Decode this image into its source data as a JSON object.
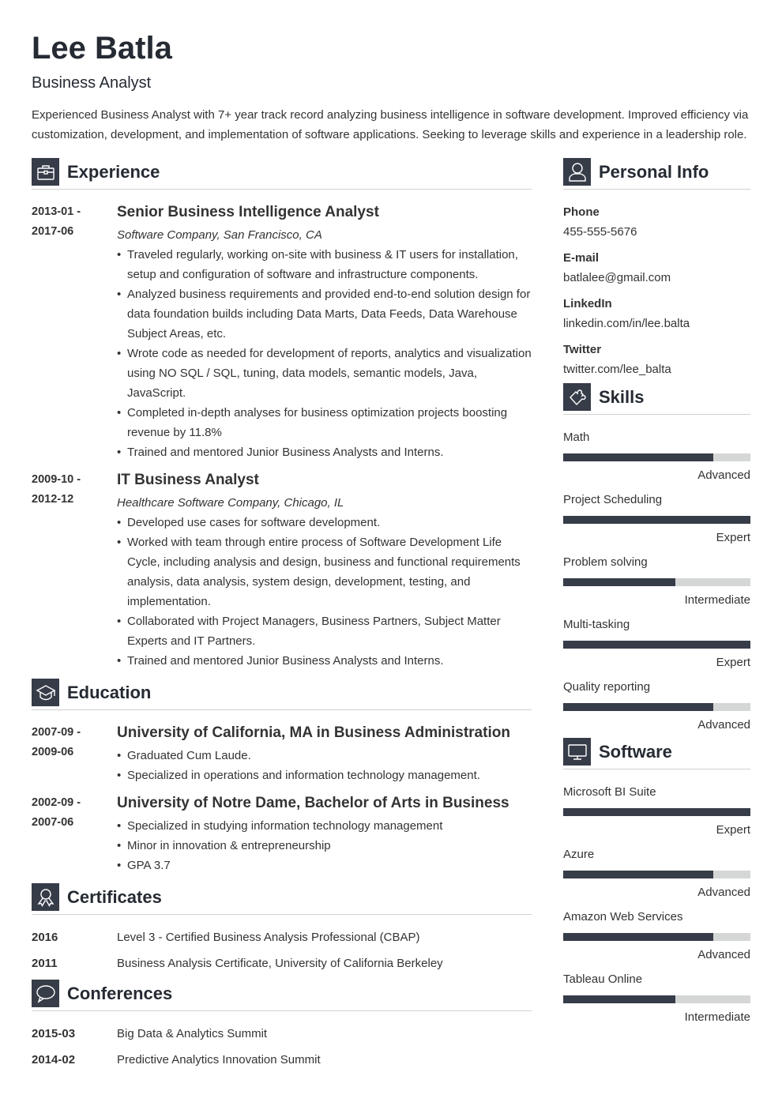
{
  "header": {
    "name": "Lee Batla",
    "title": "Business Analyst",
    "summary": "Experienced Business Analyst with 7+ year track record analyzing business intelligence in software development. Improved efficiency via customization, development, and implementation of software applications. Seeking to leverage skills and experience in a leadership role."
  },
  "experience": {
    "heading": "Experience",
    "icon": "briefcase-icon",
    "items": [
      {
        "date_start": "2013-01 -",
        "date_end": "2017-06",
        "title": "Senior Business Intelligence Analyst",
        "company": " Software Company, San Francisco, CA",
        "bullets": [
          "Traveled regularly, working on-site with business & IT users for installation, setup and configuration of software and infrastructure components.",
          "Analyzed business requirements and provided end-to-end solution design for data foundation builds including Data Marts, Data Feeds, Data Warehouse Subject Areas, etc.",
          "Wrote code as needed for development of reports, analytics and visualization using NO SQL / SQL, tuning, data models, semantic models, Java, JavaScript.",
          "Completed in-depth analyses for business optimization projects boosting revenue by 11.8%",
          "Trained and mentored Junior Business Analysts and Interns."
        ]
      },
      {
        "date_start": "2009-10 -",
        "date_end": "2012-12",
        "title": "IT Business Analyst",
        "company": "Healthcare Software Company, Chicago, IL",
        "bullets": [
          "Developed use cases for software development.",
          "Worked with team through entire process of Software Development Life Cycle, including analysis and design, business and functional requirements analysis, data analysis, system design, development, testing, and implementation.",
          "Collaborated with Project Managers, Business Partners, Subject Matter Experts and IT Partners.",
          "Trained and mentored Junior Business Analysts and Interns."
        ]
      }
    ]
  },
  "education": {
    "heading": "Education",
    "icon": "graduation-cap-icon",
    "items": [
      {
        "date_start": "2007-09 -",
        "date_end": "2009-06",
        "title": "University of California, MA in Business Administration",
        "bullets": [
          "Graduated Cum Laude.",
          "Specialized in operations and information technology management."
        ]
      },
      {
        "date_start": "2002-09 -",
        "date_end": "2007-06",
        "title": "University of Notre Dame, Bachelor of Arts in Business",
        "bullets": [
          "Specialized in studying information technology management",
          "Minor in innovation & entrepreneurship",
          "GPA 3.7"
        ]
      }
    ]
  },
  "certificates": {
    "heading": "Certificates",
    "icon": "award-ribbon-icon",
    "items": [
      {
        "year": "2016",
        "text": "Level 3 - Certified Business Analysis Professional (CBAP)"
      },
      {
        "year": "2011",
        "text": "Business Analysis Certificate, University of California Berkeley"
      }
    ]
  },
  "conferences": {
    "heading": "Conferences",
    "icon": "speech-bubble-icon",
    "items": [
      {
        "year": "2015-03",
        "text": "Big Data & Analytics Summit"
      },
      {
        "year": "2014-02",
        "text": "Predictive Analytics Innovation Summit"
      }
    ]
  },
  "personal_info": {
    "heading": "Personal Info",
    "icon": "user-icon",
    "fields": [
      {
        "label": "Phone",
        "value": "455-555-5676"
      },
      {
        "label": "E-mail",
        "value": "batlalee@gmail.com"
      },
      {
        "label": "LinkedIn",
        "value": "linkedin.com/in/lee.balta"
      },
      {
        "label": "Twitter",
        "value": "twitter.com/lee_balta"
      }
    ]
  },
  "skills": {
    "heading": "Skills",
    "icon": "puzzle-piece-icon",
    "items": [
      {
        "name": "Math",
        "level": "Advanced",
        "percent": 80
      },
      {
        "name": "Project Scheduling",
        "level": "Expert",
        "percent": 100
      },
      {
        "name": "Problem solving",
        "level": "Intermediate",
        "percent": 60
      },
      {
        "name": "Multi-tasking",
        "level": "Expert",
        "percent": 100
      },
      {
        "name": "Quality reporting",
        "level": "Advanced",
        "percent": 80
      }
    ]
  },
  "software": {
    "heading": "Software",
    "icon": "monitor-icon",
    "items": [
      {
        "name": "Microsoft BI Suite",
        "level": "Expert",
        "percent": 100
      },
      {
        "name": "Azure",
        "level": "Advanced",
        "percent": 80
      },
      {
        "name": "Amazon Web Services",
        "level": "Advanced",
        "percent": 80
      },
      {
        "name": "Tableau Online",
        "level": "Intermediate",
        "percent": 60
      }
    ]
  },
  "colors": {
    "accent": "#363c48",
    "bar_track": "#d5d6d6",
    "text": "#333333",
    "heading": "#252a33"
  }
}
